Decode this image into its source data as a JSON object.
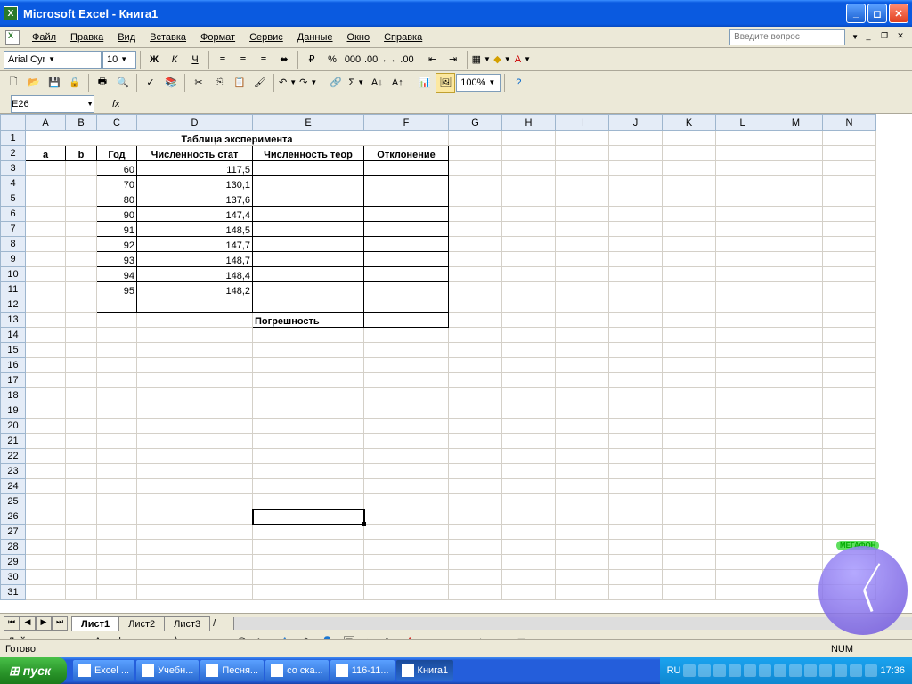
{
  "window": {
    "title": "Microsoft Excel - Книга1"
  },
  "menu": {
    "file": "Файл",
    "edit": "Правка",
    "view": "Вид",
    "insert": "Вставка",
    "format": "Формат",
    "tools": "Сервис",
    "data": "Данные",
    "window": "Окно",
    "help": "Справка",
    "question_placeholder": "Введите вопрос"
  },
  "format_bar": {
    "font_name": "Arial Cyr",
    "font_size": "10",
    "bold": "Ж",
    "italic": "К",
    "underline": "Ч"
  },
  "standard_bar": {
    "zoom": "100%"
  },
  "namebox": {
    "cell_ref": "E26",
    "fx": "fx"
  },
  "columns": [
    "A",
    "B",
    "C",
    "D",
    "E",
    "F",
    "G",
    "H",
    "I",
    "J",
    "K",
    "L",
    "M",
    "N"
  ],
  "table": {
    "title": "Таблица эксперимента",
    "headers": {
      "a": "a",
      "b": "b",
      "year": "Год",
      "stat": "Численность стат",
      "theor": "Численность теор",
      "dev": "Отклонение"
    },
    "rows": [
      {
        "year": "60",
        "stat": "117,5"
      },
      {
        "year": "70",
        "stat": "130,1"
      },
      {
        "year": "80",
        "stat": "137,6"
      },
      {
        "year": "90",
        "stat": "147,4"
      },
      {
        "year": "91",
        "stat": "148,5"
      },
      {
        "year": "92",
        "stat": "147,7"
      },
      {
        "year": "93",
        "stat": "148,7"
      },
      {
        "year": "94",
        "stat": "148,4"
      },
      {
        "year": "95",
        "stat": "148,2"
      }
    ],
    "error_label": "Погрешность"
  },
  "sheet_tabs": {
    "s1": "Лист1",
    "s2": "Лист2",
    "s3": "Лист3"
  },
  "drawing_bar": {
    "actions": "Действия",
    "autoshapes": "Автофигуры"
  },
  "status": {
    "ready": "Готово",
    "num": "NUM"
  },
  "taskbar": {
    "start": "пуск",
    "items": [
      "Excel ...",
      "Учебн...",
      "Песня...",
      "со ска...",
      "116-11...",
      "Книга1"
    ],
    "lang": "RU",
    "time": "17:36"
  },
  "clock_widget": {
    "brand": "МЕГАФОН"
  }
}
